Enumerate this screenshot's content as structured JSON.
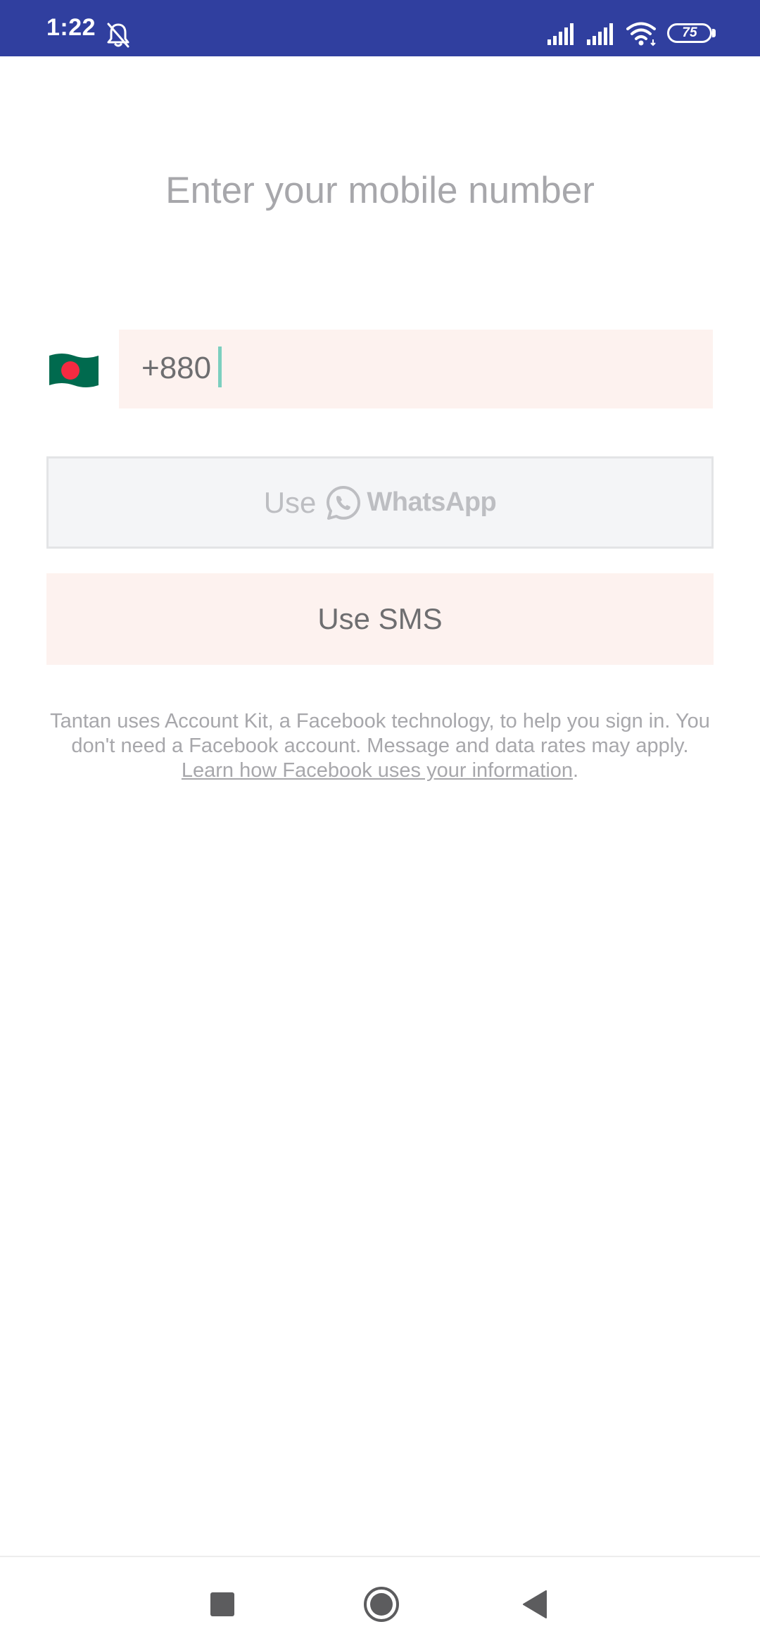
{
  "status_bar": {
    "time": "1:22",
    "battery_level": "75",
    "icons": [
      "bell-off-icon",
      "signal-icon",
      "signal-icon",
      "wifi-icon",
      "battery-icon"
    ]
  },
  "main": {
    "title": "Enter your mobile number",
    "country_flag": "bangladesh-flag-icon",
    "phone_prefix": "+880",
    "whatsapp_button": {
      "use_label": "Use",
      "brand_label": "WhatsApp"
    },
    "sms_button": {
      "label": "Use SMS"
    },
    "disclaimer": {
      "text": "Tantan uses Account Kit, a Facebook technology, to help you sign in. You don't need a Facebook account. Message and data rates may apply. ",
      "link_text": "Learn how Facebook uses your information",
      "suffix": "."
    }
  },
  "nav_bar": {
    "icons": [
      "recents-icon",
      "home-icon",
      "back-icon"
    ]
  },
  "colors": {
    "status_bar_bg": "#303f9f",
    "field_bg": "#fdf2ef",
    "whatsapp_button_bg": "#f4f5f7",
    "cursor": "#7ccfbf",
    "muted_text": "#a7a7ab",
    "primary_text": "#6e6e70",
    "flag_green": "#006a4e",
    "flag_red": "#f42a41"
  }
}
